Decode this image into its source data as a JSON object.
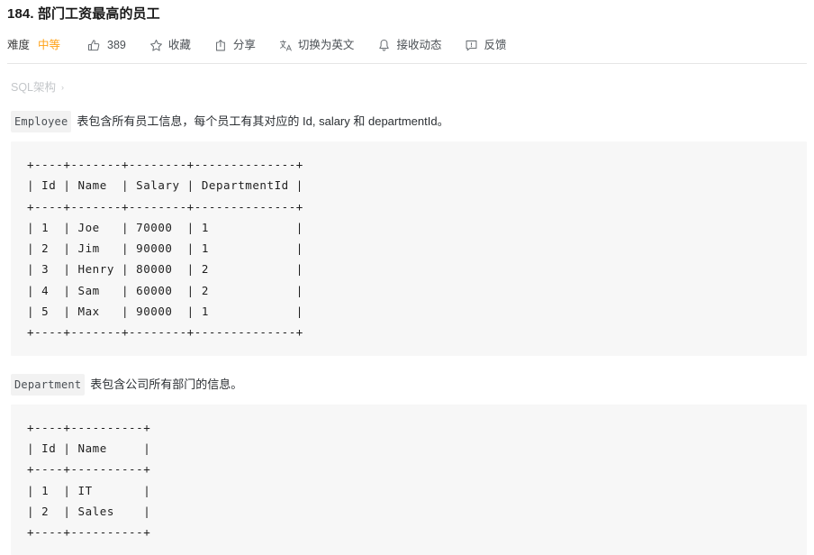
{
  "problem": {
    "number_title": "184. 部门工资最高的员工"
  },
  "toolbar": {
    "difficulty_label": "难度",
    "difficulty_value": "中等",
    "like_count": "389",
    "favorite_label": "收藏",
    "share_label": "分享",
    "translate_label": "切换为英文",
    "subscribe_label": "接收动态",
    "feedback_label": "反馈",
    "icons": {
      "like": "thumbs-up-icon",
      "favorite": "star-icon",
      "share": "share-box-icon",
      "translate": "translate-icon",
      "subscribe": "bell-icon",
      "feedback": "feedback-bubble-icon"
    },
    "accent_medium": "#ffa116"
  },
  "breadcrumb": {
    "label": "SQL架构",
    "chevron": "›"
  },
  "description": {
    "employee_code": "Employee",
    "employee_text": "表包含所有员工信息，每个员工有其对应的 Id, salary 和 departmentId。",
    "department_code": "Department",
    "department_text": "表包含公司所有部门的信息。"
  },
  "employee_table": "+----+-------+--------+--------------+\n| Id | Name  | Salary | DepartmentId |\n+----+-------+--------+--------------+\n| 1  | Joe   | 70000  | 1            |\n| 2  | Jim   | 90000  | 1            |\n| 3  | Henry | 80000  | 2            |\n| 4  | Sam   | 60000  | 2            |\n| 5  | Max   | 90000  | 1            |\n+----+-------+--------+--------------+",
  "department_table": "+----+----------+\n| Id | Name     |\n+----+----------+\n| 1  | IT       |\n| 2  | Sales    |\n+----+----------+"
}
